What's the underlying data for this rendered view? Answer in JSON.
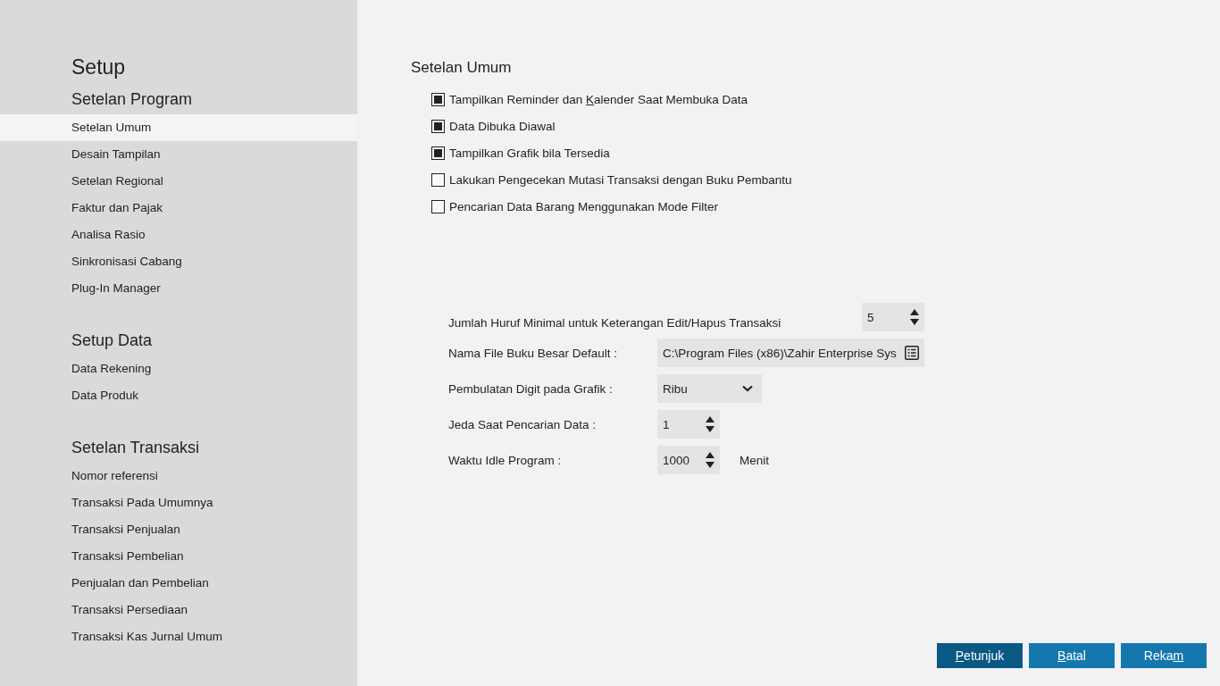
{
  "sidebar": {
    "title": "Setup",
    "sections": [
      {
        "heading": "Setelan Program",
        "items": [
          {
            "label": "Setelan Umum",
            "selected": true
          },
          {
            "label": "Desain Tampilan",
            "selected": false
          },
          {
            "label": "Setelan Regional",
            "selected": false
          },
          {
            "label": "Faktur dan Pajak",
            "selected": false
          },
          {
            "label": "Analisa Rasio",
            "selected": false
          },
          {
            "label": "Sinkronisasi Cabang",
            "selected": false
          },
          {
            "label": "Plug-In Manager",
            "selected": false
          }
        ]
      },
      {
        "heading": "Setup Data",
        "items": [
          {
            "label": "Data Rekening",
            "selected": false
          },
          {
            "label": "Data Produk",
            "selected": false
          }
        ]
      },
      {
        "heading": "Setelan Transaksi",
        "items": [
          {
            "label": "Nomor referensi",
            "selected": false
          },
          {
            "label": "Transaksi Pada Umumnya",
            "selected": false
          },
          {
            "label": "Transaksi Penjualan",
            "selected": false
          },
          {
            "label": "Transaksi Pembelian",
            "selected": false
          },
          {
            "label": "Penjualan dan Pembelian",
            "selected": false
          },
          {
            "label": "Transaksi Persediaan",
            "selected": false
          },
          {
            "label": "Transaksi Kas Jurnal Umum",
            "selected": false
          }
        ]
      }
    ]
  },
  "main": {
    "title": "Setelan Umum",
    "options": [
      {
        "before": "Tampilkan Reminder dan ",
        "key": "K",
        "after": "alender Saat Membuka Data",
        "checked": true
      },
      {
        "before": "Data Dibuka Diawal",
        "checked": true
      },
      {
        "before": "Tampilkan Grafik bila Tersedia",
        "checked": true
      },
      {
        "before": "Lakukan Pengecekan Mutasi Transaksi dengan Buku Pembantu",
        "checked": false
      },
      {
        "before": "Pencarian Data Barang Menggunakan Mode Filter",
        "checked": false
      }
    ],
    "fields": [
      {
        "kind": "spinner",
        "label": "Jumlah Huruf Minimal untuk Keterangan Edit/Hapus Transaksi",
        "value": "5"
      },
      {
        "kind": "file",
        "label": "Nama File Buku Besar Default :",
        "value": "C:\\Program Files (x86)\\Zahir Enterprise Sys"
      },
      {
        "kind": "dropdown",
        "label": "Pembulatan Digit pada Grafik :",
        "value": "Ribu"
      },
      {
        "kind": "spinner",
        "label": "Jeda Saat Pencarian Data :",
        "value": "1"
      },
      {
        "kind": "spinner",
        "label": "Waktu Idle Program :",
        "value": "1000",
        "unit": "Menit"
      }
    ]
  },
  "buttons": [
    {
      "key": "P",
      "after": "etunjuk",
      "selected": true
    },
    {
      "key": "B",
      "after": "atal",
      "selected": false
    },
    {
      "before": "Reka",
      "key": "m",
      "selected": false
    }
  ]
}
